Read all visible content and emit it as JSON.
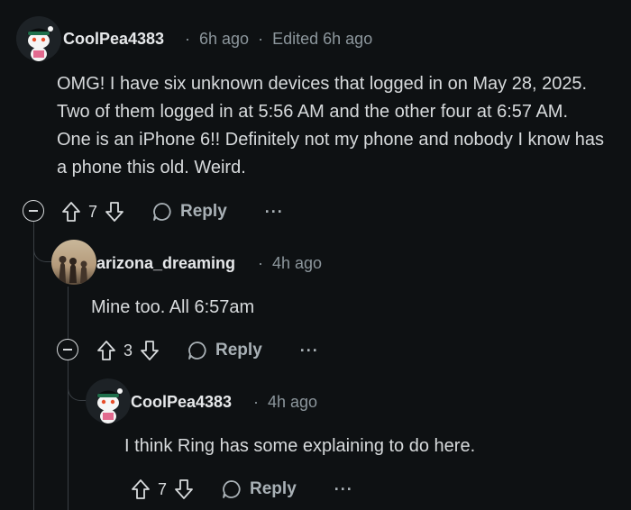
{
  "comments": [
    {
      "username": "CoolPea4383",
      "time": "6h ago",
      "edited": "Edited 6h ago",
      "body": "OMG! I have six unknown devices that logged in on May 28, 2025. Two of them logged in at 5:56 AM and the other four at 6:57 AM. One is an iPhone 6!! Definitely not my phone and nobody I know has a phone this old. Weird.",
      "votes": "7",
      "reply_label": "Reply",
      "more": "···"
    },
    {
      "username": "arizona_dreaming",
      "time": "4h ago",
      "body": "Mine too. All 6:57am",
      "votes": "3",
      "reply_label": "Reply",
      "more": "···"
    },
    {
      "username": "CoolPea4383",
      "time": "4h ago",
      "body": "I think Ring has some explaining to do here.",
      "votes": "7",
      "reply_label": "Reply",
      "more": "···"
    }
  ],
  "separator": "·",
  "colors": {
    "background": "#0e1113",
    "text": "#d7dadc",
    "meta": "#8c969c",
    "thread_line": "#3a3f44"
  },
  "icons": [
    "snoo-avatar-icon",
    "sunset-photo-avatar",
    "collapse-icon",
    "upvote-icon",
    "downvote-icon",
    "reply-bubble-icon",
    "more-options-icon"
  ]
}
